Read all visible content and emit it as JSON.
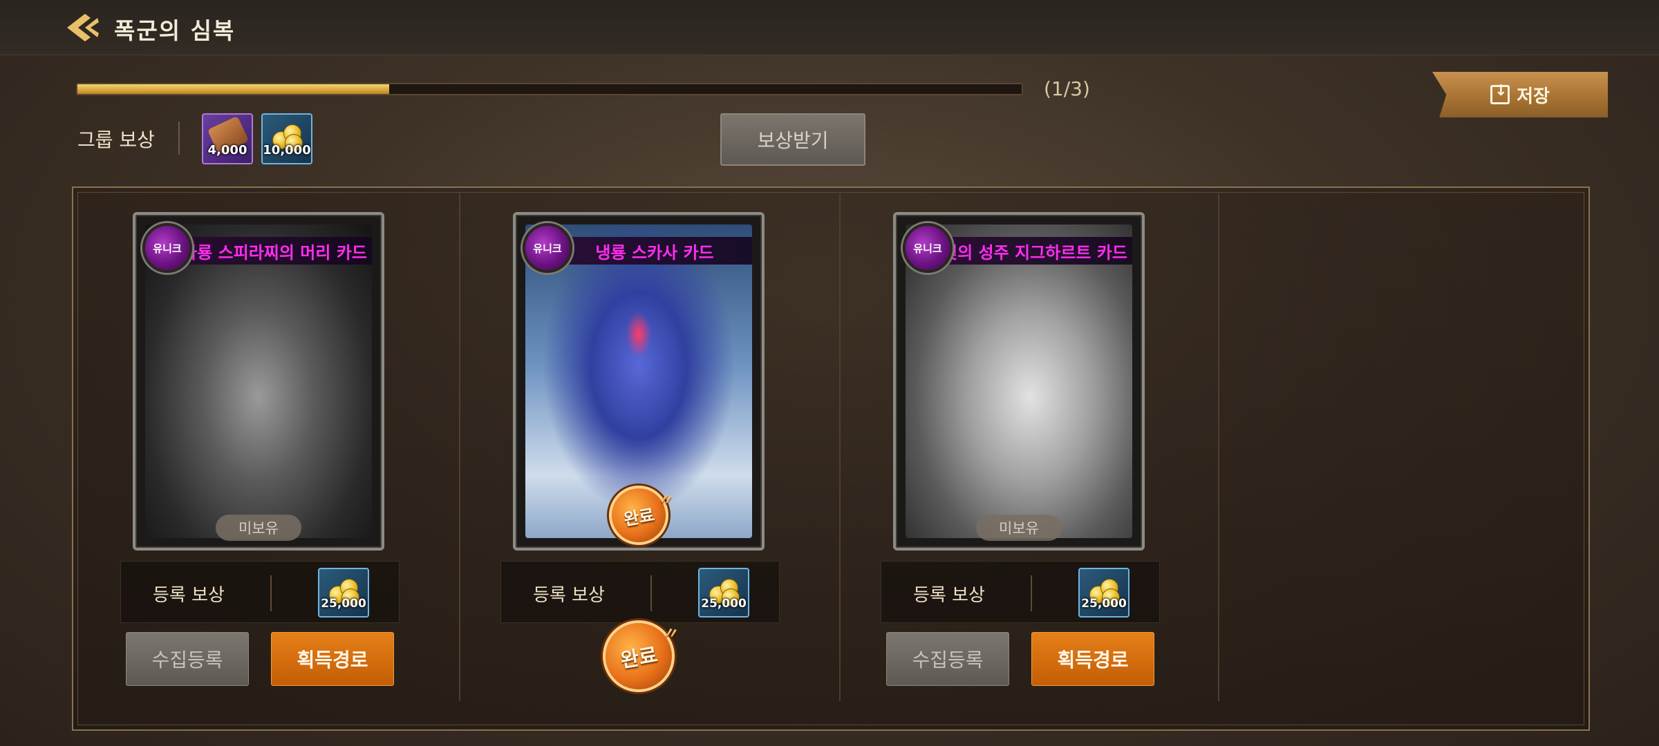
{
  "header": {
    "title": "폭군의 심복"
  },
  "progress": {
    "label": "(1/3)",
    "ratio": 0.33
  },
  "save_button": {
    "label": "저장"
  },
  "group_reward": {
    "label": "그룹 보상",
    "items": [
      {
        "icon": "scroll-icon",
        "quantity": "4,000"
      },
      {
        "icon": "gold-coins-icon",
        "quantity": "10,000"
      }
    ],
    "claim_label": "보상받기"
  },
  "cards": [
    {
      "rarity": "유니크",
      "title": "사룡 스피라찌의 머리 카드",
      "status": "미보유",
      "completed": false,
      "reg_label": "등록 보상",
      "reg_reward_qty": "25,000",
      "register_label": "수집등록",
      "acquire_label": "획득경로"
    },
    {
      "rarity": "유니크",
      "title": "냉룡 스카사 카드",
      "status": "완료",
      "completed": true,
      "reg_label": "등록 보상",
      "reg_reward_qty": "25,000",
      "complete_stamp": "완료"
    },
    {
      "rarity": "유니크",
      "title": "빛의 성주 지그하르트 카드",
      "status": "미보유",
      "completed": false,
      "reg_label": "등록 보상",
      "reg_reward_qty": "25,000",
      "register_label": "수집등록",
      "acquire_label": "획득경로"
    }
  ],
  "colors": {
    "accent_gold": "#d8a53c",
    "card_title": "#ff2df0",
    "rarity_purple": "#8a1fa6",
    "action_orange": "#d96c10"
  }
}
